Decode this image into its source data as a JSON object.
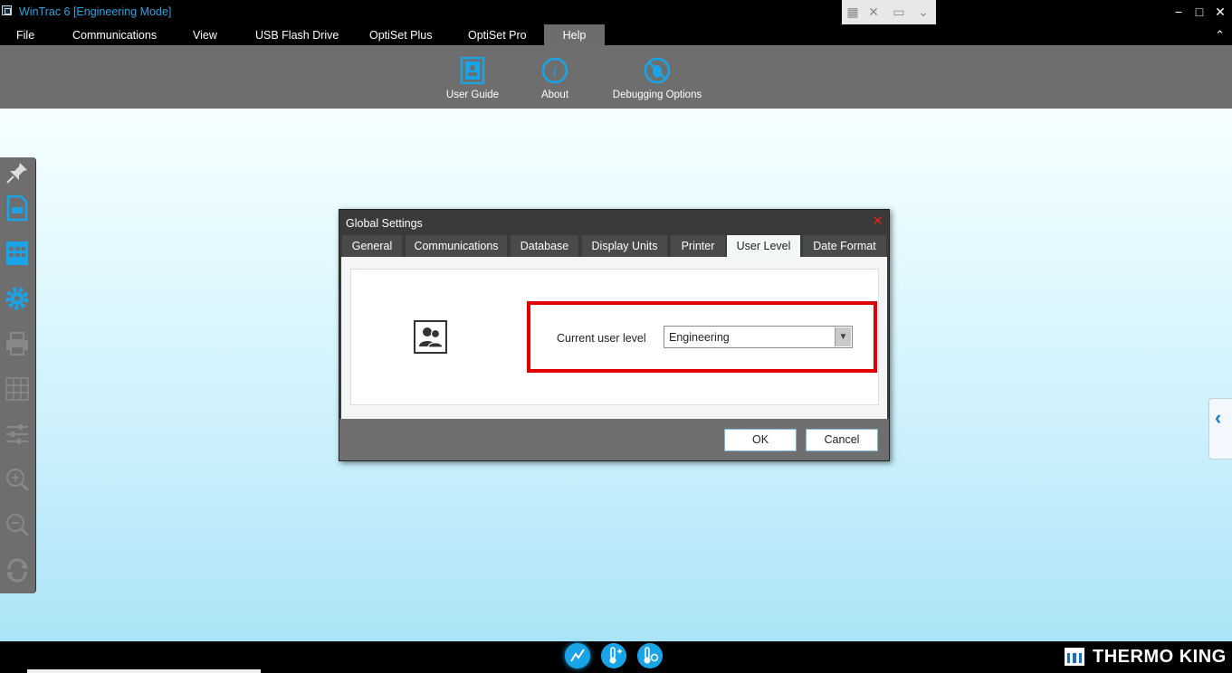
{
  "window": {
    "title": "WinTrac 6 [Engineering Mode]",
    "controls": [
      "minimize",
      "maximize",
      "close"
    ]
  },
  "menu": {
    "tabs": [
      {
        "label": "File"
      },
      {
        "label": "Communications"
      },
      {
        "label": "View"
      },
      {
        "label": "USB Flash Drive"
      },
      {
        "label": "OptiSet Plus"
      },
      {
        "label": "OptiSet Pro"
      },
      {
        "label": "Help",
        "active": true
      }
    ]
  },
  "ribbon": {
    "buttons": [
      {
        "label": "User Guide",
        "icon": "user-guide-icon"
      },
      {
        "label": "About",
        "icon": "info-icon"
      },
      {
        "label": "Debugging Options",
        "icon": "debug-icon"
      }
    ]
  },
  "left_toolbar": {
    "icons": [
      "pin-icon",
      "document-icon",
      "calendar-icon",
      "gear-icon",
      "printer-icon",
      "grid-icon",
      "sliders-icon",
      "zoom-in-icon",
      "zoom-out-icon",
      "refresh-icon"
    ]
  },
  "dialog": {
    "title": "Global Settings",
    "tabs": [
      {
        "label": "General"
      },
      {
        "label": "Communications"
      },
      {
        "label": "Database"
      },
      {
        "label": "Display Units"
      },
      {
        "label": "Printer"
      },
      {
        "label": "User Level",
        "active": true
      },
      {
        "label": "Date Format"
      }
    ],
    "user_level": {
      "label": "Current user level",
      "value": "Engineering"
    },
    "buttons": {
      "ok": "OK",
      "cancel": "Cancel"
    }
  },
  "statusbar": {
    "brand": "THERMO KING",
    "icons": [
      "chart-icon",
      "thermometer-add-icon",
      "thermometer-settings-icon"
    ]
  },
  "colors": {
    "accent": "#1aa4e8",
    "title_text": "#29a3e8",
    "highlight": "#e00000",
    "ribbon_bg": "#6e6e6e"
  }
}
